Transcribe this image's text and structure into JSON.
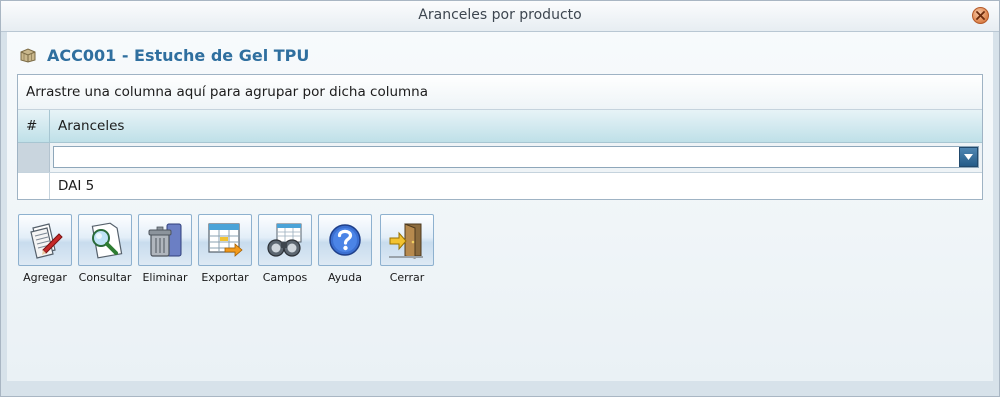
{
  "window": {
    "title": "Aranceles por producto"
  },
  "heading": {
    "text": "ACC001 - Estuche de Gel TPU"
  },
  "grid": {
    "group_panel_text": "Arrastre una columna aquí para agrupar por dicha columna",
    "columns": [
      "#",
      "Aranceles"
    ],
    "filter_value": "",
    "rows": [
      {
        "num": "",
        "arancel": "DAI 5"
      }
    ]
  },
  "toolbar": {
    "buttons": [
      {
        "label": "Agregar",
        "icon": "add-document-icon"
      },
      {
        "label": "Consultar",
        "icon": "magnifier-document-icon"
      },
      {
        "label": "Eliminar",
        "icon": "trash-can-icon"
      },
      {
        "label": "Exportar",
        "icon": "spreadsheet-export-icon"
      },
      {
        "label": "Campos",
        "icon": "binoculars-icon"
      },
      {
        "label": "Ayuda",
        "icon": "help-icon"
      },
      {
        "label": "Cerrar",
        "icon": "exit-door-icon"
      }
    ]
  },
  "colors": {
    "heading_text": "#2f6f9f",
    "header_gradient_top": "#e7f3f7",
    "header_gradient_bottom": "#bfe0e8",
    "window_bg": "#d7e2ea"
  }
}
